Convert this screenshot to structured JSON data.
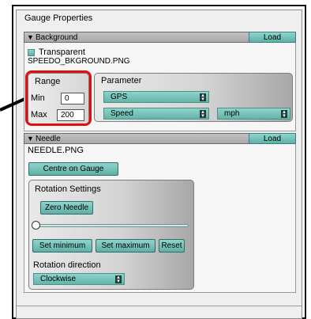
{
  "dialog": {
    "title": "Gauge Properties"
  },
  "background": {
    "header": "Background",
    "load_label": "Load",
    "transparent_label": "Transparent",
    "filename": "SPEEDO_BKGROUND.PNG",
    "range": {
      "title": "Range",
      "min_label": "Min",
      "min_value": "0",
      "max_label": "Max",
      "max_value": "200"
    },
    "parameter": {
      "title": "Parameter",
      "source": "GPS",
      "value": "Speed",
      "unit": "mph"
    }
  },
  "needle": {
    "header": "Needle",
    "load_label": "Load",
    "filename": "NEEDLE.PNG",
    "centre_label": "Centre on Gauge",
    "rotation": {
      "title": "Rotation Settings",
      "zero_label": "Zero Needle",
      "slider_fraction": 0,
      "set_min_label": "Set minimum",
      "set_max_label": "Set maximum",
      "reset_label": "Reset",
      "direction_label": "Rotation direction",
      "direction_value": "Clockwise"
    }
  },
  "colors": {
    "accent": "#6fbfb6",
    "highlight": "#e01010"
  }
}
